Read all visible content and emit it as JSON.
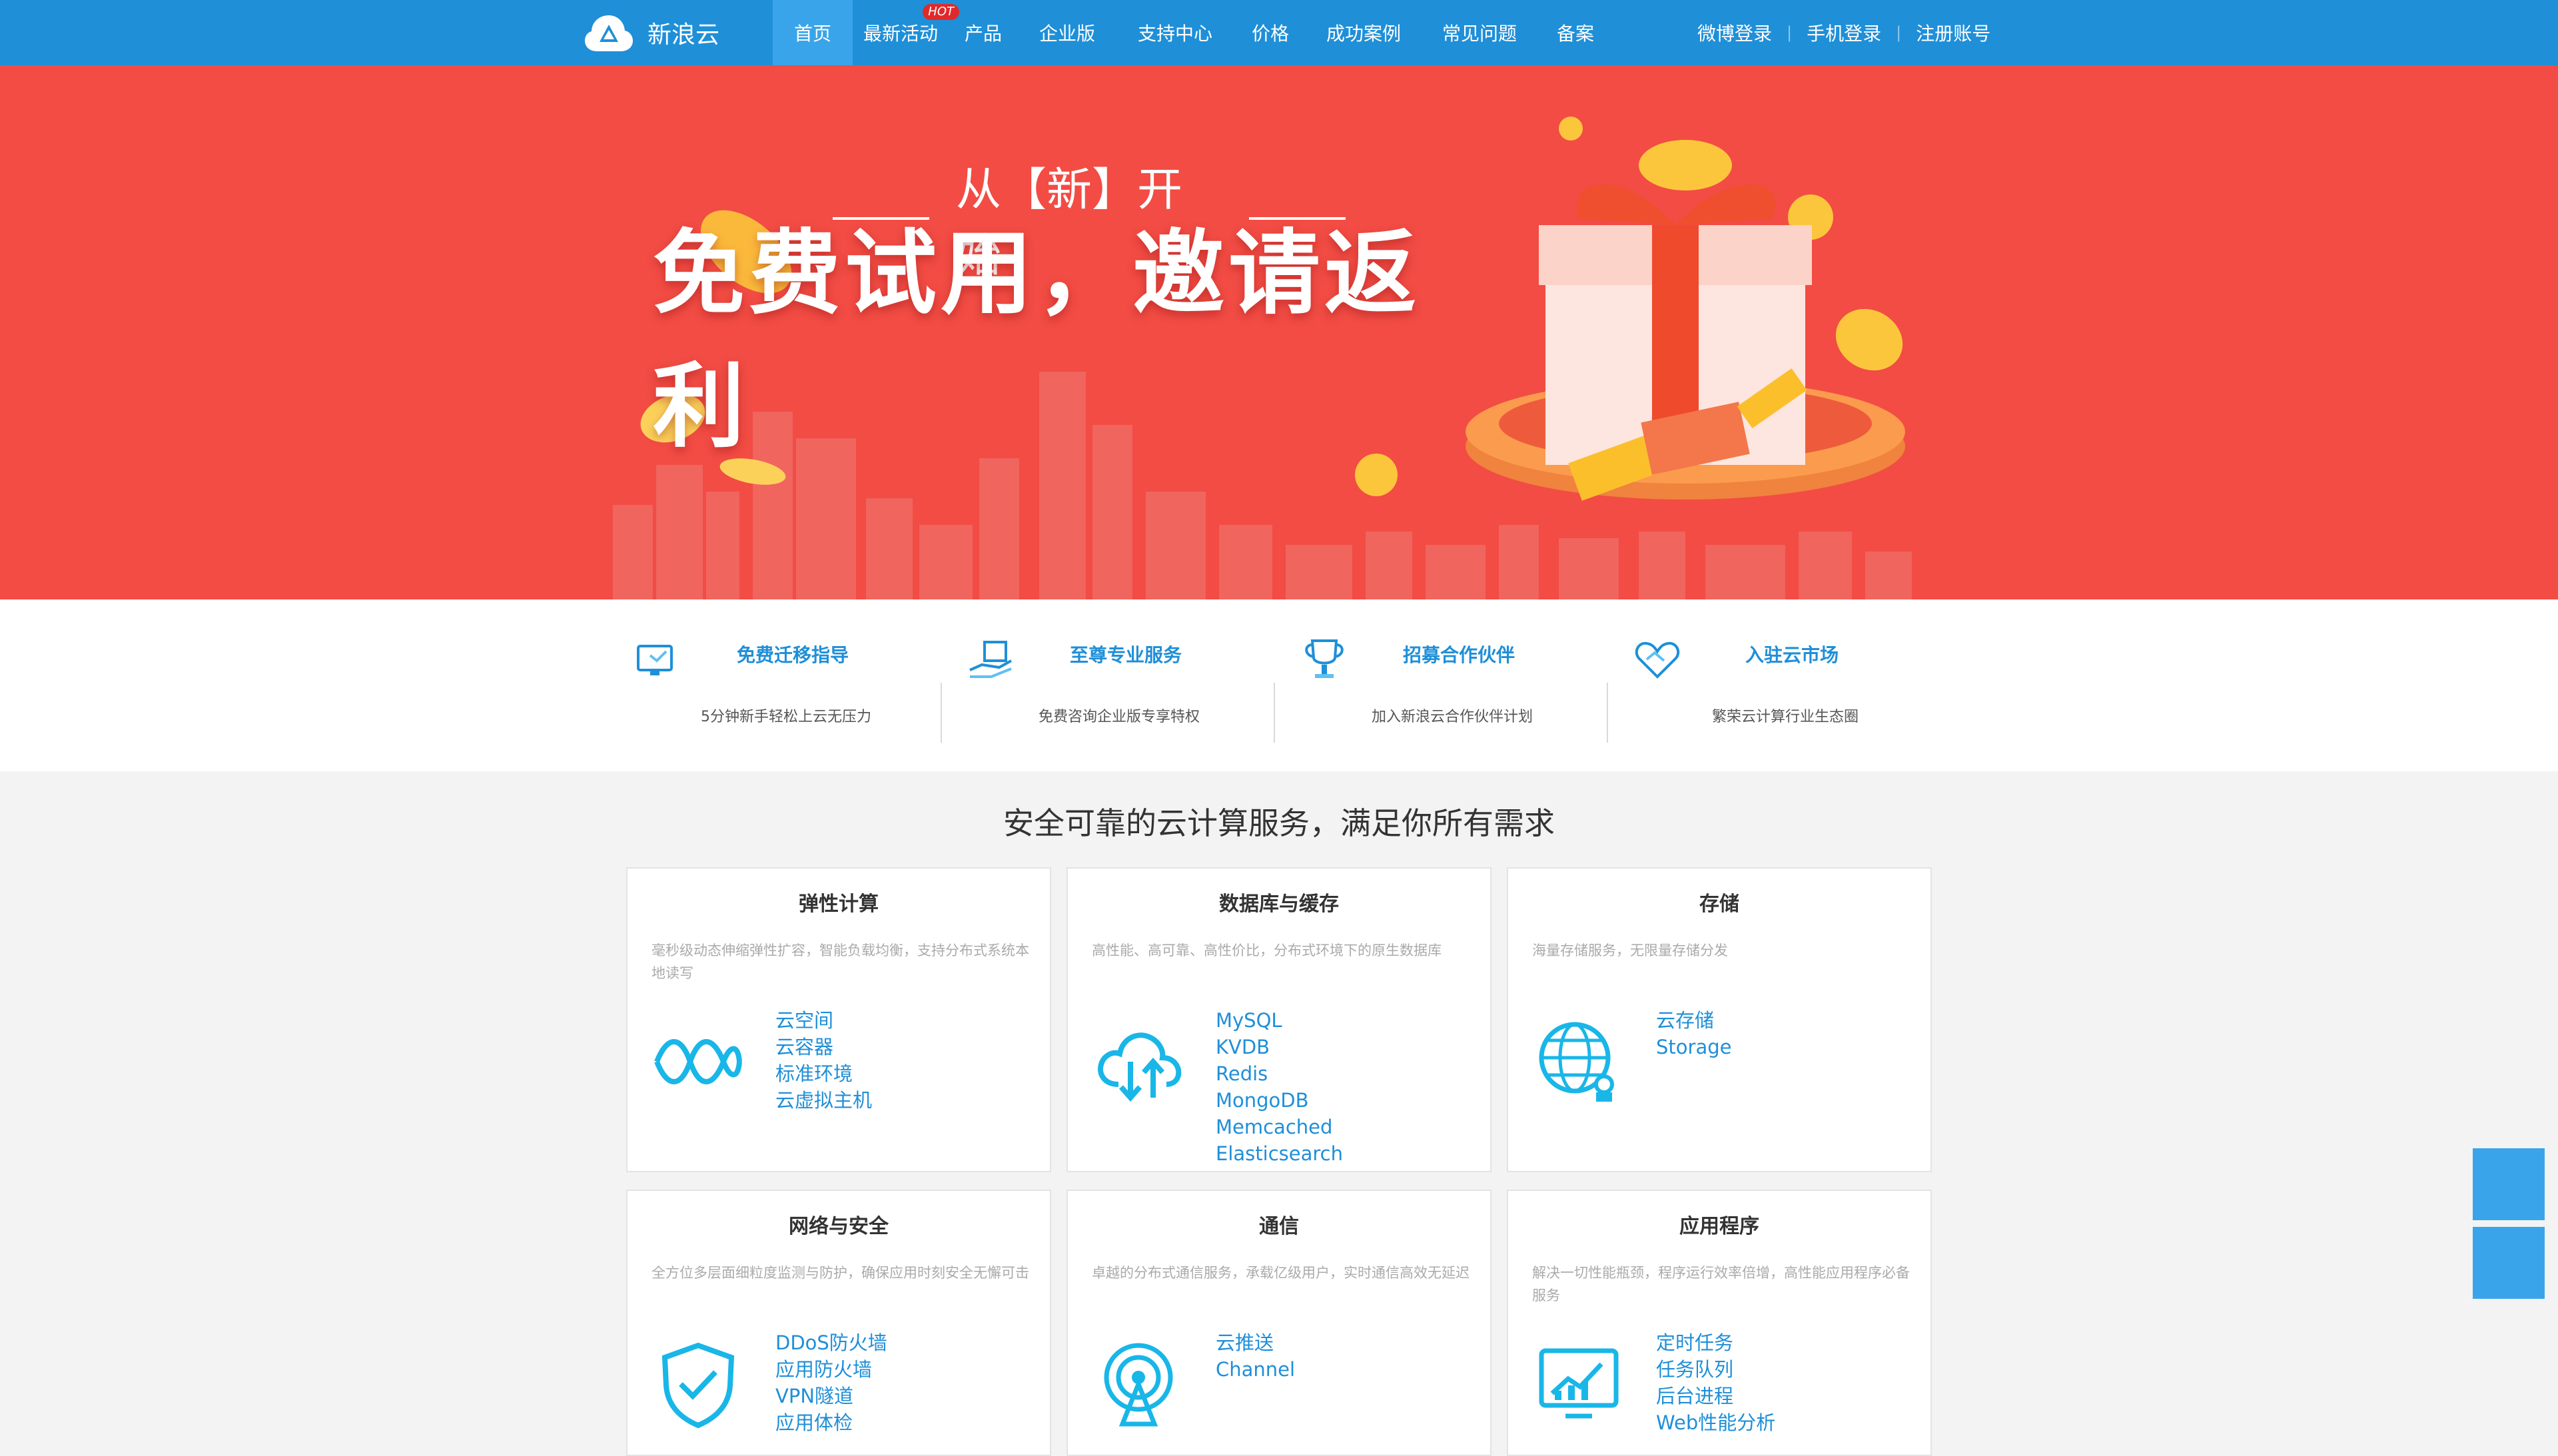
{
  "brand": {
    "name": "新浪云",
    "color": "#1f8fd8"
  },
  "nav": [
    {
      "label": "首页",
      "active": true
    },
    {
      "label": "最新活动",
      "badge": "HOT"
    },
    {
      "label": "产品"
    },
    {
      "label": "企业版"
    },
    {
      "label": "支持中心"
    },
    {
      "label": "价格"
    },
    {
      "label": "成功案例"
    },
    {
      "label": "常见问题"
    },
    {
      "label": "备案"
    }
  ],
  "account": {
    "weibo_login": "微博登录",
    "phone_login": "手机登录",
    "register": "注册账号",
    "separator": "|"
  },
  "banner": {
    "subtitle": "从【新】开始",
    "title": "免费试用，邀请返利",
    "background": "#f24c44"
  },
  "features": [
    {
      "icon": "monitor-icon",
      "title": "免费迁移指导",
      "desc": "5分钟新手轻松上云无压力"
    },
    {
      "icon": "service-hand-icon",
      "title": "至尊专业服务",
      "desc": "免费咨询企业版专享特权"
    },
    {
      "icon": "trophy-icon",
      "title": "招募合作伙伴",
      "desc": "加入新浪云合作伙伴计划"
    },
    {
      "icon": "handshake-icon",
      "title": "入驻云市场",
      "desc": "繁荣云计算行业生态圈"
    }
  ],
  "section_title": "安全可靠的云计算服务，满足你所有需求",
  "cards": [
    {
      "icon": "elastic-compute-icon",
      "title": "弹性计算",
      "desc": "毫秒级动态伸缩弹性扩容，智能负载均衡，支持分布式系统本地读写",
      "links": [
        "云空间",
        "云容器",
        "标准环境",
        "云虚拟主机"
      ]
    },
    {
      "icon": "cloud-sync-icon",
      "title": "数据库与缓存",
      "desc": "高性能、高可靠、高性价比，分布式环境下的原生数据库",
      "links": [
        "MySQL",
        "KVDB",
        "Redis",
        "MongoDB",
        "Memcached",
        "Elasticsearch"
      ]
    },
    {
      "icon": "globe-storage-icon",
      "title": "存储",
      "desc": "海量存储服务，无限量存储分发",
      "links": [
        "云存储",
        "Storage"
      ]
    },
    {
      "icon": "shield-check-icon",
      "title": "网络与安全",
      "desc": "全方位多层面细粒度监测与防护，确保应用时刻安全无懈可击",
      "links": [
        "DDoS防火墙",
        "应用防火墙",
        "VPN隧道",
        "应用体检"
      ]
    },
    {
      "icon": "broadcast-icon",
      "title": "通信",
      "desc": "卓越的分布式通信服务，承载亿级用户，实时通信高效无延迟",
      "links": [
        "云推送",
        "Channel"
      ]
    },
    {
      "icon": "monitor-chart-icon",
      "title": "应用程序",
      "desc": "解决一切性能瓶颈，程序运行效率倍增，高性能应用程序必备服务",
      "links": [
        "定时任务",
        "任务队列",
        "后台进程",
        "Web性能分析"
      ]
    }
  ],
  "side_buttons": [
    "side-button-1",
    "side-button-2"
  ]
}
